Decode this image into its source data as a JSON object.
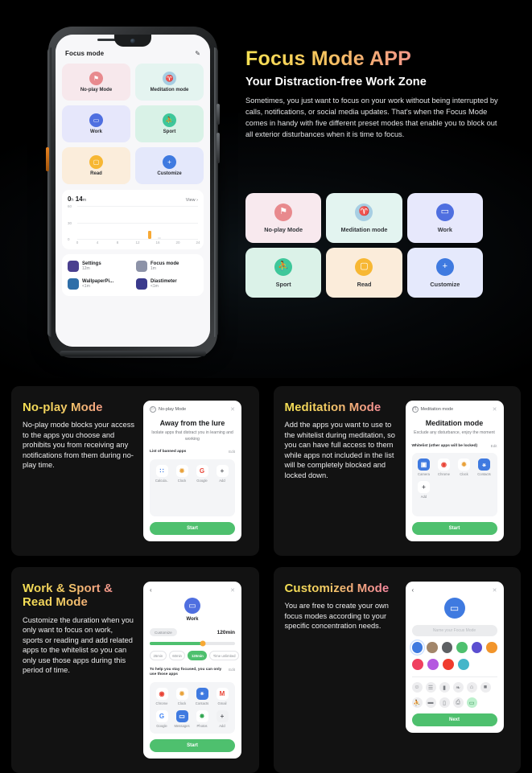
{
  "hero": {
    "title": "Focus Mode APP",
    "subtitle": "Your Distraction-free Work Zone",
    "body": "Sometimes, you just want to focus on your work without being interrupted by calls, notifications, or social media updates. That's when the Focus Mode comes in handy with five different preset modes that enable you to block out all exterior disturbances when it is time to focus."
  },
  "phone": {
    "screen_title": "Focus mode",
    "edit_icon": "pencil-icon",
    "modes": [
      {
        "label": "No-play Mode",
        "icon": "graduation-cap-icon",
        "glyph": "⚑",
        "icon_color": "#e88a8e",
        "bg": "#f7e8ec"
      },
      {
        "label": "Meditation mode",
        "icon": "meditation-icon",
        "glyph": "♈",
        "icon_color": "#a6cde2",
        "bg": "#e4f4f0"
      },
      {
        "label": "Work",
        "icon": "briefcase-icon",
        "glyph": "▭",
        "icon_color": "#4f6fe0",
        "bg": "#e6e7fb"
      },
      {
        "label": "Sport",
        "icon": "runner-icon",
        "glyph": "⛹",
        "icon_color": "#3ec79a",
        "bg": "#d9f2e7"
      },
      {
        "label": "Read",
        "icon": "book-icon",
        "glyph": "▢",
        "icon_color": "#f7b733",
        "bg": "#fbeddb"
      },
      {
        "label": "Customize",
        "icon": "plus-icon",
        "glyph": "+",
        "icon_color": "#3f7ae0",
        "bg": "#e4e8fb"
      }
    ],
    "usage": {
      "duration_hours": "0",
      "unit_hours": "h",
      "duration_minutes": "14",
      "unit_minutes": "m",
      "view_label": "View"
    },
    "apps": [
      {
        "name": "Settings",
        "time": "12m",
        "icon": "settings-gear-icon",
        "color": "#4a3f8f"
      },
      {
        "name": "Focus mode",
        "time": "1m",
        "icon": "focus-mode-icon",
        "color": "#8d93a8"
      },
      {
        "name": "WallpaperPi...",
        "time": "<1m",
        "icon": "wallpaper-icon",
        "color": "#2f6ea8"
      },
      {
        "name": "Diastimeter",
        "time": "<1m",
        "icon": "diastimeter-icon",
        "color": "#3a3a8c"
      }
    ]
  },
  "chart_data": {
    "type": "bar",
    "title": "0 h 14 m",
    "xlabel": "",
    "ylabel": "",
    "x": [
      0,
      2,
      4,
      6,
      8,
      10,
      12,
      14,
      16,
      18,
      20,
      22,
      24
    ],
    "values": [
      0,
      0,
      0,
      0,
      0,
      0,
      0,
      14,
      2,
      0,
      0,
      0,
      0
    ],
    "xticks": [
      "0",
      "4",
      "8",
      "12",
      "16",
      "20",
      "24"
    ],
    "yticks": [
      "0",
      "30",
      "60"
    ],
    "xlim": [
      0,
      24
    ],
    "ylim": [
      0,
      60
    ],
    "grid": true,
    "bar_color": "#f7a935",
    "legend": "none"
  },
  "mode_cards": [
    {
      "label": "No-play Mode",
      "icon": "graduation-cap-icon",
      "glyph": "⚑",
      "icon_color": "#e8898d",
      "bg": "#f8e9ee"
    },
    {
      "label": "Meditation mode",
      "icon": "meditation-icon",
      "glyph": "♈",
      "icon_color": "#a7cee3",
      "bg": "#e3f4f0"
    },
    {
      "label": "Work",
      "icon": "briefcase-icon",
      "glyph": "▭",
      "icon_color": "#4f6fe0",
      "bg": "#e7e8fc"
    },
    {
      "label": "Sport",
      "icon": "runner-icon",
      "glyph": "⛹",
      "icon_color": "#3ec79a",
      "bg": "#dbf2e8"
    },
    {
      "label": "Read",
      "icon": "book-icon",
      "glyph": "▢",
      "icon_color": "#f7b733",
      "bg": "#fbecda"
    },
    {
      "label": "Customize",
      "icon": "plus-icon",
      "glyph": "+",
      "icon_color": "#3f7ae0",
      "bg": "#e5e9fc"
    }
  ],
  "features": {
    "noplay": {
      "title": "No-play Mode",
      "desc": "No-play mode blocks your access to the apps you choose and prohibits you from receiving any notifications from them during no-play time.",
      "panel": {
        "header": "No-play Mode",
        "close_icon": "close-icon",
        "heading": "Away from the lure",
        "subheading": "Isolate apps that distract you in learning and working",
        "list_label": "List of banned apps",
        "edit_label": "Edit",
        "apps": [
          {
            "name": "Calcula..",
            "icon": "calculator-icon",
            "glyph": "∷",
            "color": "#3f7ae0",
            "bg": "#ffffff"
          },
          {
            "name": "Clock",
            "icon": "clock-icon",
            "glyph": "✹",
            "color": "#e9a23b",
            "bg": "#ffffff"
          },
          {
            "name": "Google",
            "icon": "google-icon",
            "glyph": "G",
            "color": "#e94335",
            "bg": "#ffffff"
          },
          {
            "name": "Add",
            "icon": "plus-icon",
            "glyph": "+",
            "color": "#5b5e63",
            "bg": "#ffffff"
          }
        ],
        "button": "Start"
      }
    },
    "meditation": {
      "title": "Meditation Mode",
      "desc": "Add the apps you want to use to the whitelist during meditation, so you can have full access to them while apps not included in the list will be completely blocked and locked down.",
      "panel": {
        "header": "Meditation mode",
        "close_icon": "close-icon",
        "heading": "Meditation mode",
        "subheading": "Exclude any disturbance, enjoy the moment",
        "list_label": "Whitelist (other apps will be locked)",
        "edit_label": "Edit",
        "apps": [
          {
            "name": "Camera",
            "icon": "camera-icon",
            "glyph": "▣",
            "color": "#ffffff",
            "bg": "#3f7ae0"
          },
          {
            "name": "Chrome",
            "icon": "chrome-icon",
            "glyph": "◉",
            "color": "#e94335",
            "bg": "#ffffff"
          },
          {
            "name": "Clock",
            "icon": "clock-icon",
            "glyph": "✹",
            "color": "#e9a23b",
            "bg": "#ffffff"
          },
          {
            "name": "Contacts",
            "icon": "contacts-icon",
            "glyph": "⚹",
            "color": "#ffffff",
            "bg": "#3f7ae0"
          },
          {
            "name": "Add",
            "icon": "plus-icon",
            "glyph": "+",
            "color": "#5b5e63",
            "bg": "#ffffff"
          }
        ],
        "button": "Start"
      }
    },
    "work": {
      "title": "Work & Sport & Read Mode",
      "desc": "Customize the duration when you only want to focus on work, sports or reading and add related apps to the whitelist so you can only use those apps during this period of time.",
      "panel": {
        "back_icon": "back-arrow-icon",
        "close_icon": "close-icon",
        "mode_icon": "briefcase-icon",
        "mode_glyph": "▭",
        "mode_color": "#4f6fe0",
        "mode_name": "Work",
        "customize_label": "Customize",
        "duration_value": "120min",
        "chips": [
          {
            "label": "25min",
            "selected": false
          },
          {
            "label": "60min",
            "selected": false
          },
          {
            "label": "120min",
            "selected": true
          },
          {
            "label": "Time unlimited",
            "selected": false
          }
        ],
        "list_label": "To help you stay focused, you can only use those apps",
        "edit_label": "Edit",
        "apps": [
          {
            "name": "Chrome",
            "icon": "chrome-icon",
            "glyph": "◉",
            "color": "#e94335",
            "bg": "#ffffff"
          },
          {
            "name": "Clock",
            "icon": "clock-icon",
            "glyph": "✹",
            "color": "#e9a23b",
            "bg": "#ffffff"
          },
          {
            "name": "Contacts",
            "icon": "contacts-icon",
            "glyph": "⚹",
            "color": "#ffffff",
            "bg": "#3f7ae0"
          },
          {
            "name": "Gmail",
            "icon": "gmail-icon",
            "glyph": "M",
            "color": "#e94335",
            "bg": "#ffffff"
          },
          {
            "name": "Google",
            "icon": "google-icon",
            "glyph": "G",
            "color": "#4285f4",
            "bg": "#ffffff"
          },
          {
            "name": "Messages",
            "icon": "messages-icon",
            "glyph": "▭",
            "color": "#ffffff",
            "bg": "#3f7ae0"
          },
          {
            "name": "Photos",
            "icon": "photos-icon",
            "glyph": "✸",
            "color": "#34a853",
            "bg": "#ffffff"
          },
          {
            "name": "Add",
            "icon": "plus-icon",
            "glyph": "+",
            "color": "#5b5e63",
            "bg": "#f0f1f3"
          }
        ],
        "button": "Start"
      }
    },
    "customized": {
      "title": "Customized Mode",
      "desc": "You are free to create your own focus modes according to your specific concentration needs.",
      "panel": {
        "back_icon": "back-arrow-icon",
        "close_icon": "close-icon",
        "mode_icon": "card-icon",
        "mode_glyph": "▭",
        "mode_color": "#3f7ae0",
        "name_placeholder": "Name your Focus Mode",
        "colors": [
          "#3f7ae0",
          "#a2866a",
          "#5d6063",
          "#4ec06e",
          "#5b4ed0",
          "#f2952b",
          "#f04060",
          "#b458e0",
          "#f03c2e",
          "#45b6c9"
        ],
        "selected_color_index": 0,
        "icons": [
          {
            "icon": "smiley-icon",
            "glyph": "☺",
            "selected": false
          },
          {
            "icon": "list-icon",
            "glyph": "☰",
            "selected": false
          },
          {
            "icon": "bookmark-icon",
            "glyph": "▮",
            "selected": false
          },
          {
            "icon": "leaf-icon",
            "glyph": "❧",
            "selected": false
          },
          {
            "icon": "home-icon",
            "glyph": "⌂",
            "selected": false
          },
          {
            "icon": "briefcase-icon",
            "glyph": "■",
            "selected": false
          },
          {
            "icon": "runner-icon",
            "glyph": "⛹",
            "selected": false
          },
          {
            "icon": "bed-icon",
            "glyph": "▬",
            "selected": false
          },
          {
            "icon": "book-icon",
            "glyph": "▯",
            "selected": false
          },
          {
            "icon": "print-icon",
            "glyph": "⎙",
            "selected": false
          },
          {
            "icon": "card-icon",
            "glyph": "▭",
            "selected": true
          }
        ],
        "button": "Next"
      }
    }
  }
}
